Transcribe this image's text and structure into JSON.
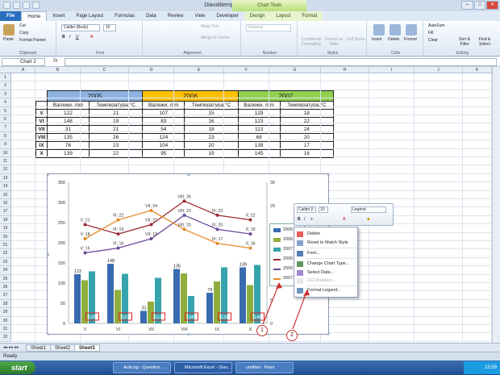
{
  "window": {
    "title": "Diavalitemp090317 - Microsoft Excel",
    "chart_tools": "Chart Tools"
  },
  "tabs": [
    "Home",
    "Insert",
    "Page Layout",
    "Formulas",
    "Data",
    "Review",
    "View",
    "Developer",
    "Design",
    "Layout",
    "Format"
  ],
  "file_tab": "File",
  "ribbon": {
    "paste": "Paste",
    "cut": "Cut",
    "copy": "Copy",
    "format_painter": "Format Painter",
    "clipboard": "Clipboard",
    "font_name": "Calibri (Body)",
    "font_size": "10",
    "font": "Font",
    "wrap_text": "Wrap Text",
    "merge_center": "Merge & Center",
    "alignment": "Alignment",
    "number_format": "General",
    "number": "Number",
    "conditional": "Conditional Formatting",
    "format_table": "Format as Table",
    "cell_styles": "Cell Styles",
    "styles": "Styles",
    "insert": "Insert",
    "delete": "Delete",
    "format": "Format",
    "cells": "Cells",
    "autosum": "AutoSum",
    "fill": "Fill",
    "clear": "Clear",
    "sort_filter": "Sort & Filter",
    "find_select": "Find & Select",
    "editing": "Editing"
  },
  "name_box": "Chart 2",
  "fx": "fx",
  "columns": [
    "A",
    "B",
    "C",
    "D",
    "E",
    "F",
    "G",
    "H",
    "I",
    "J",
    "K"
  ],
  "rows": [
    "1",
    "2",
    "3",
    "4",
    "5",
    "6",
    "7",
    "8",
    "9",
    "10",
    "11",
    "12",
    "13",
    "14",
    "15",
    "16",
    "17",
    "18",
    "19",
    "20",
    "21",
    "22",
    "23",
    "24",
    "25",
    "26",
    "27",
    "28",
    "29",
    "30",
    "31",
    "32"
  ],
  "table": {
    "years": [
      "2005",
      "2006",
      "2007"
    ],
    "year_colors": [
      "#8db3e2",
      "#ffc000",
      "#92d050"
    ],
    "headers": [
      "Валежи, mm",
      "Температура,°C",
      "Валежи, mm",
      "Температура,°C",
      "Валежи, mm",
      "Температура,°C"
    ],
    "rows": [
      {
        "label": "V",
        "v": [
          "122",
          "21",
          "107",
          "15",
          "129",
          "18"
        ]
      },
      {
        "label": "VI",
        "v": [
          "148",
          "19",
          "83",
          "16",
          "123",
          "22"
        ]
      },
      {
        "label": "VII",
        "v": [
          "31",
          "21",
          "54",
          "18",
          "113",
          "24"
        ]
      },
      {
        "label": "VIII",
        "v": [
          "135",
          "26",
          "124",
          "23",
          "68",
          "20"
        ]
      },
      {
        "label": "IX",
        "v": [
          "76",
          "23",
          "104",
          "20",
          "139",
          "17"
        ]
      },
      {
        "label": "X",
        "v": [
          "139",
          "22",
          "95",
          "19",
          "145",
          "16"
        ]
      }
    ]
  },
  "chart_data": {
    "type": "bar",
    "categories": [
      "V",
      "VI",
      "VII",
      "VIII",
      "IX",
      "X"
    ],
    "ylim_left": [
      0,
      350
    ],
    "ylim_right": [
      0,
      30
    ],
    "left_ticks": [
      "0",
      "50",
      "100",
      "150",
      "200",
      "250",
      "300",
      "350"
    ],
    "right_ticks": [
      "0",
      "5",
      "10",
      "15",
      "20",
      "25",
      "30"
    ],
    "series": [
      {
        "name": "2005",
        "kind": "bar",
        "color": "#3a6bb0",
        "values": [
          122,
          148,
          31,
          135,
          76,
          139
        ]
      },
      {
        "name": "2006",
        "kind": "bar",
        "color": "#8fae3e",
        "values": [
          107,
          83,
          54,
          124,
          104,
          95
        ]
      },
      {
        "name": "2007",
        "kind": "bar",
        "color": "#37a3ad",
        "values": [
          129,
          123,
          113,
          68,
          139,
          145
        ]
      },
      {
        "name": "2005",
        "kind": "line",
        "color": "#9a2e36",
        "values": [
          21,
          19,
          21,
          26,
          23,
          22
        ]
      },
      {
        "name": "2006",
        "kind": "line",
        "color": "#6a4a98",
        "values": [
          15,
          16,
          18,
          23,
          20,
          19
        ]
      },
      {
        "name": "2007",
        "kind": "line",
        "color": "#e58a2a",
        "values": [
          18,
          22,
          24,
          20,
          17,
          16
        ]
      }
    ],
    "bar_labels_2005": [
      "122",
      "148",
      "31",
      "135",
      "76",
      "139"
    ],
    "bar_labels_2007": [
      "129",
      "123",
      "113",
      "68",
      "139",
      "145"
    ],
    "line_labels": {
      "2005": [
        "V; 21",
        "VI; 19",
        "VII; 21",
        "VIII; 26",
        "IX; 23",
        "X; 22"
      ],
      "2006": [
        "V; 15",
        "VI; 16",
        "VII; 18",
        "VIII; 23",
        "IX; 20",
        "X; 19"
      ],
      "2007": [
        "V; 18",
        "VI; 22",
        "VII; 24",
        "VIII; 20",
        "IX; 17",
        "X; 16"
      ]
    }
  },
  "legend": [
    "2005",
    "2006",
    "2007",
    "2005",
    "2006",
    "2007"
  ],
  "minitoolbar": {
    "font": "Calibri (I",
    "size": "10",
    "element": "Legend"
  },
  "context_menu": [
    {
      "label": "Delete",
      "disabled": false
    },
    {
      "label": "Reset to Match Style",
      "disabled": false
    },
    {
      "label": "Font...",
      "disabled": false
    },
    {
      "label": "Change Chart Type...",
      "disabled": false
    },
    {
      "label": "Select Data...",
      "disabled": false
    },
    {
      "label": "3-D Rotation...",
      "disabled": true
    },
    {
      "label": "Format Legend...",
      "disabled": false
    }
  ],
  "annotations": [
    "1",
    "2"
  ],
  "sheets": [
    "Sheet1",
    "Sheet2",
    "Sheet3"
  ],
  "status": "Ready",
  "taskbar": {
    "start": "start",
    "items": [
      "Aula.bg - Question ...",
      "Microsoft Excel - Diav...",
      "untitled - Paint"
    ],
    "clock": "15:59"
  }
}
